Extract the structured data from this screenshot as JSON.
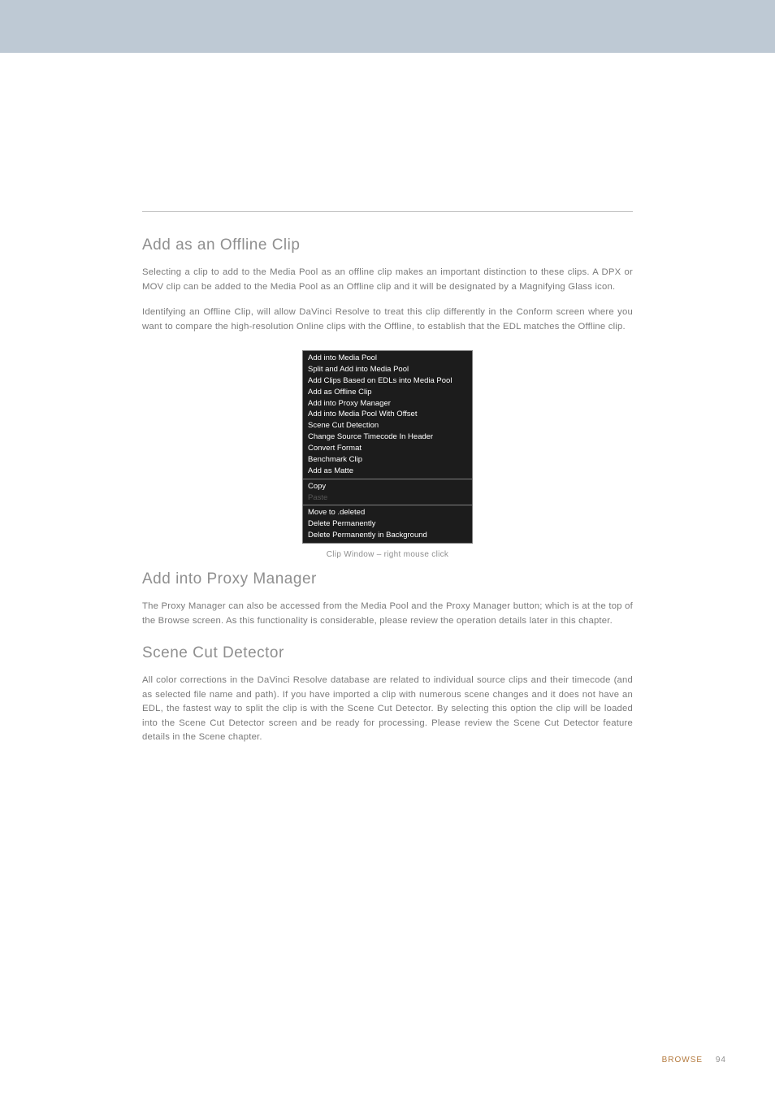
{
  "s1": {
    "title": "Add as an Offline Clip",
    "p1": "Selecting a clip to add to the Media Pool as an offline clip makes an important distinction to these clips. A DPX or MOV clip can be added to the Media Pool as an Offline clip and it will be designated by a Magnifying Glass icon.",
    "p2": "Identifying an Offline Clip, will allow DaVinci Resolve to treat this clip differently in the Conform screen where you want to compare the high-resolution Online clips with the Offline, to establish that the EDL matches the Offline clip."
  },
  "menu": {
    "g1": [
      "Add into Media Pool",
      "Split and Add into Media Pool",
      "Add Clips Based on EDLs into Media Pool",
      "Add as Offline Clip",
      "Add into Proxy Manager",
      "Add into Media Pool With Offset",
      "Scene Cut Detection",
      "Change Source Timecode In Header",
      "Convert Format",
      "Benchmark Clip",
      "Add as Matte"
    ],
    "g2_copy": "Copy",
    "g2_paste": "Paste",
    "g3": [
      "Move to .deleted",
      "Delete Permanently",
      "Delete Permanently in Background"
    ]
  },
  "caption": "Clip Window – right mouse click",
  "s2": {
    "title": "Add into Proxy Manager",
    "p1": "The Proxy Manager can also be accessed from the Media Pool and the Proxy Manager button; which is at the top of the Browse screen. As this functionality is considerable, please review the operation details later in this chapter."
  },
  "s3": {
    "title": "Scene Cut Detector",
    "p1": "All color corrections in the DaVinci Resolve database are related to individual source clips and their timecode (and as selected file name and path). If you have imported a clip with numerous scene changes and it does not have an EDL, the fastest way to split the clip is with the Scene Cut Detector. By selecting this option the clip will be loaded into the Scene Cut Detector screen and be ready for processing. Please review the Scene Cut Detector feature details in the Scene chapter."
  },
  "footer": {
    "section": "BROWSE",
    "page": "94"
  }
}
